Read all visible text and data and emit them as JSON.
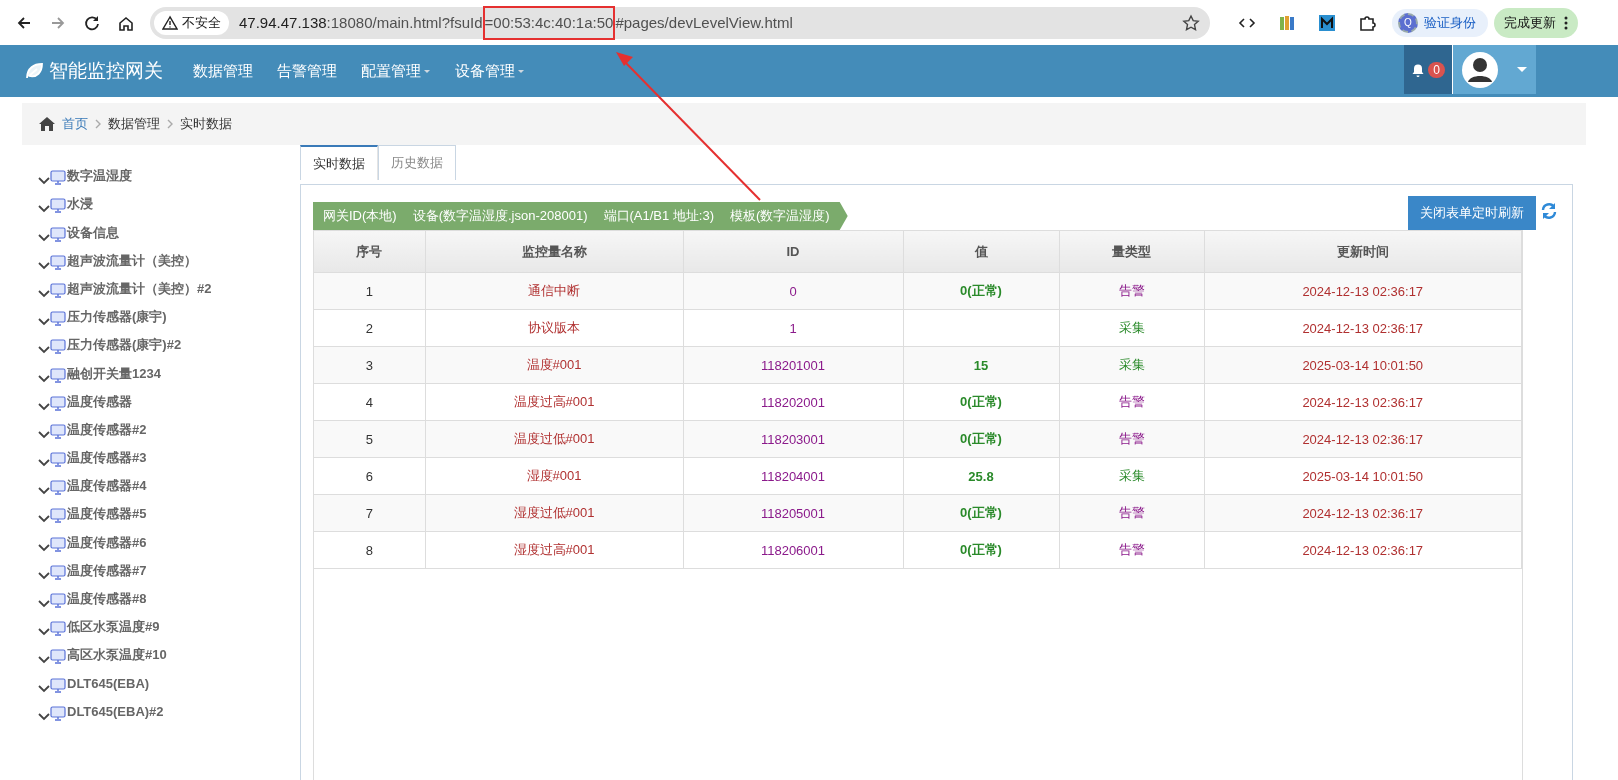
{
  "browser": {
    "security_label": "不安全",
    "url_host": "47.94.47.138",
    "url_path": ":18080/main.html?fsuId",
    "url_highlight": "=00:53:4c:40:1a:50",
    "url_tail": "#pages/devLevelView.html",
    "profile_label": "验证身份",
    "profile_initial": "Q",
    "update_button": "完成更新"
  },
  "navbar": {
    "brand": "智能监控网关",
    "menus": [
      {
        "label": "数据管理",
        "has_dropdown": false
      },
      {
        "label": "告警管理",
        "has_dropdown": false
      },
      {
        "label": "配置管理",
        "has_dropdown": true
      },
      {
        "label": "设备管理",
        "has_dropdown": true
      }
    ],
    "notification_count": "0"
  },
  "breadcrumb": [
    "首页",
    "数据管理",
    "实时数据"
  ],
  "device_tree": [
    {
      "label": "数字温湿度"
    },
    {
      "label": "水浸"
    },
    {
      "label": "设备信息"
    },
    {
      "label": "超声波流量计（美控）"
    },
    {
      "label": "超声波流量计（美控）#2"
    },
    {
      "label": "压力传感器(康宇)"
    },
    {
      "label": "压力传感器(康宇)#2"
    },
    {
      "label": "融创开关量1234"
    },
    {
      "label": "温度传感器"
    },
    {
      "label": "温度传感器#2"
    },
    {
      "label": "温度传感器#3"
    },
    {
      "label": "温度传感器#4"
    },
    {
      "label": "温度传感器#5"
    },
    {
      "label": "温度传感器#6"
    },
    {
      "label": "温度传感器#7"
    },
    {
      "label": "温度传感器#8"
    },
    {
      "label": "低区水泵温度#9"
    },
    {
      "label": "高区水泵温度#10"
    },
    {
      "label": "DLT645(EBA)"
    },
    {
      "label": "DLT645(EBA)#2"
    }
  ],
  "tabs": [
    {
      "label": "实时数据",
      "selected": true
    },
    {
      "label": "历史数据",
      "selected": false
    }
  ],
  "path": [
    "网关ID(本地)",
    "设备(数字温湿度.json-208001)",
    "端口(A1/B1 地址:3)",
    "模板(数字温湿度)"
  ],
  "refresh_button": "关闭表单定时刷新",
  "table": {
    "columns": [
      "序号",
      "监控量名称",
      "ID",
      "值",
      "量类型",
      "更新时间"
    ],
    "rows": [
      {
        "no": "1",
        "name": "通信中断",
        "id": "0",
        "value": "0(正常)",
        "type": "告警",
        "kind": "alarm",
        "time": "2024-12-13 02:36:17"
      },
      {
        "no": "2",
        "name": "协议版本",
        "id": "1",
        "value": "",
        "type": "采集",
        "kind": "collect",
        "time": "2024-12-13 02:36:17"
      },
      {
        "no": "3",
        "name": "温度#001",
        "id": "118201001",
        "value": "15",
        "type": "采集",
        "kind": "collect",
        "time": "2025-03-14 10:01:50"
      },
      {
        "no": "4",
        "name": "温度过高#001",
        "id": "118202001",
        "value": "0(正常)",
        "type": "告警",
        "kind": "alarm",
        "time": "2024-12-13 02:36:17"
      },
      {
        "no": "5",
        "name": "温度过低#001",
        "id": "118203001",
        "value": "0(正常)",
        "type": "告警",
        "kind": "alarm",
        "time": "2024-12-13 02:36:17"
      },
      {
        "no": "6",
        "name": "湿度#001",
        "id": "118204001",
        "value": "25.8",
        "type": "采集",
        "kind": "collect",
        "time": "2025-03-14 10:01:50"
      },
      {
        "no": "7",
        "name": "湿度过低#001",
        "id": "118205001",
        "value": "0(正常)",
        "type": "告警",
        "kind": "alarm",
        "time": "2024-12-13 02:36:17"
      },
      {
        "no": "8",
        "name": "湿度过高#001",
        "id": "118206001",
        "value": "0(正常)",
        "type": "告警",
        "kind": "alarm",
        "time": "2024-12-13 02:36:17"
      }
    ]
  }
}
